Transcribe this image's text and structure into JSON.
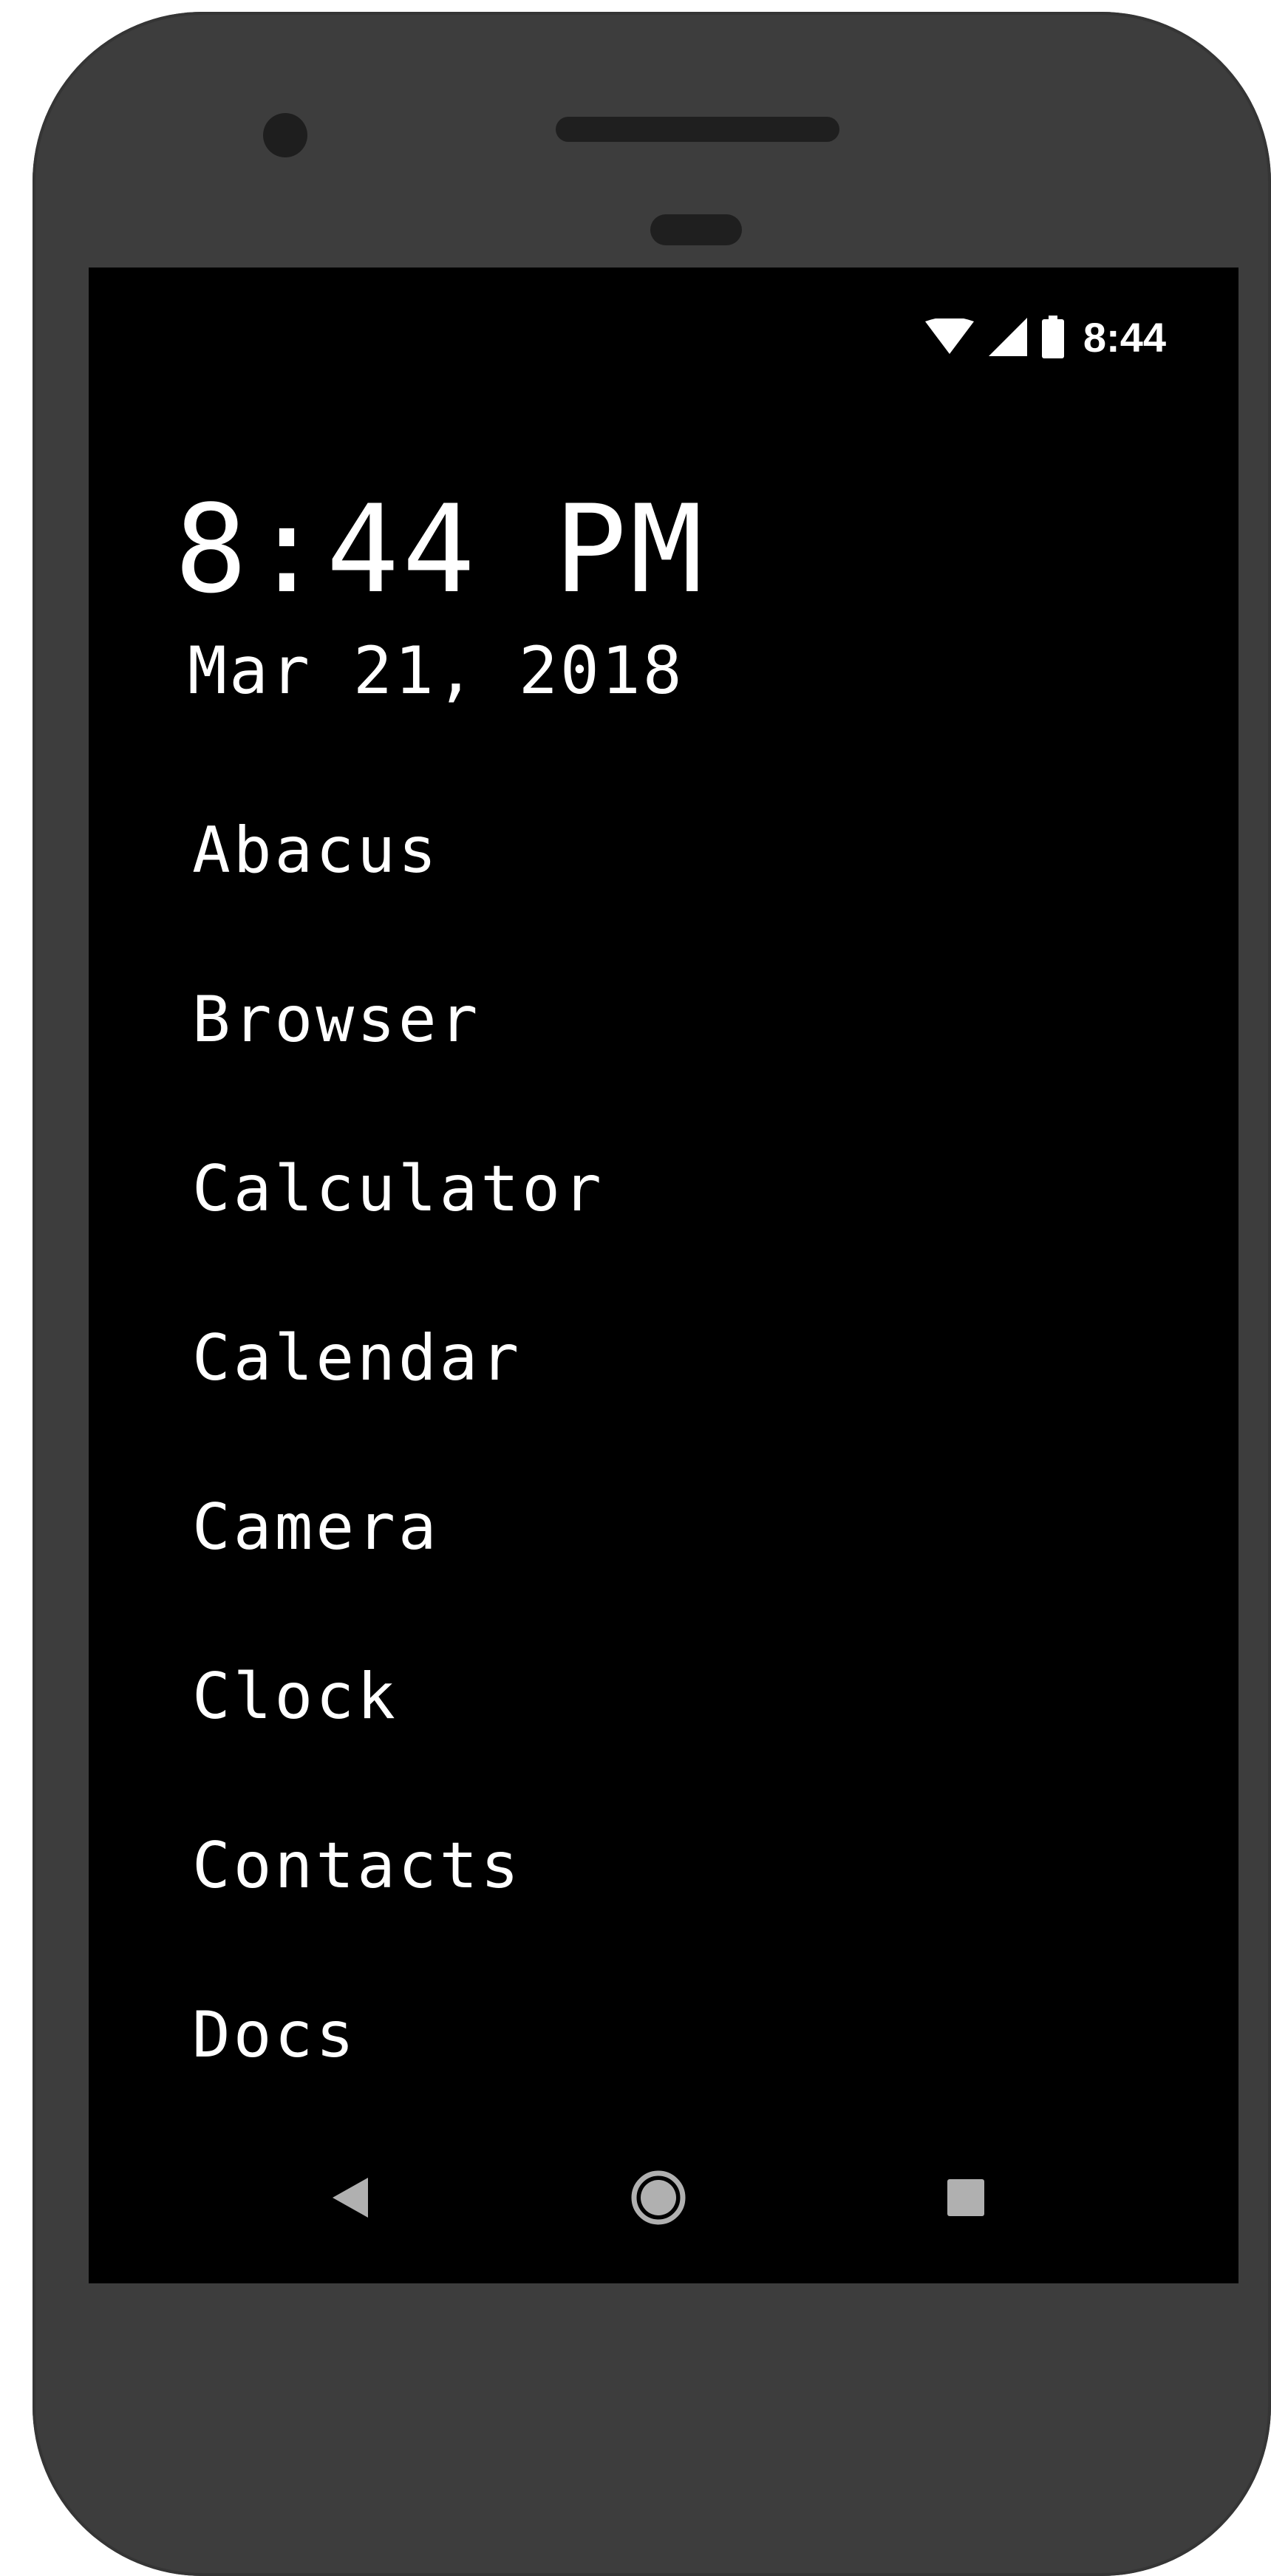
{
  "status_bar": {
    "time": "8:44",
    "icons": [
      "wifi-icon",
      "cell-signal-icon",
      "battery-icon"
    ]
  },
  "clock": {
    "time": "8:44 PM",
    "date": "Mar 21, 2018"
  },
  "apps": [
    {
      "label": "Abacus"
    },
    {
      "label": "Browser"
    },
    {
      "label": "Calculator"
    },
    {
      "label": "Calendar"
    },
    {
      "label": "Camera"
    },
    {
      "label": "Clock"
    },
    {
      "label": "Contacts"
    },
    {
      "label": "Docs"
    }
  ],
  "nav_bar": {
    "buttons": [
      "back-icon",
      "home-icon",
      "recents-icon"
    ]
  },
  "colors": {
    "device_frame": "#3d3d3d",
    "screen_background": "#000000",
    "text": "#ffffff",
    "nav_icons": "#b0b0b0"
  }
}
